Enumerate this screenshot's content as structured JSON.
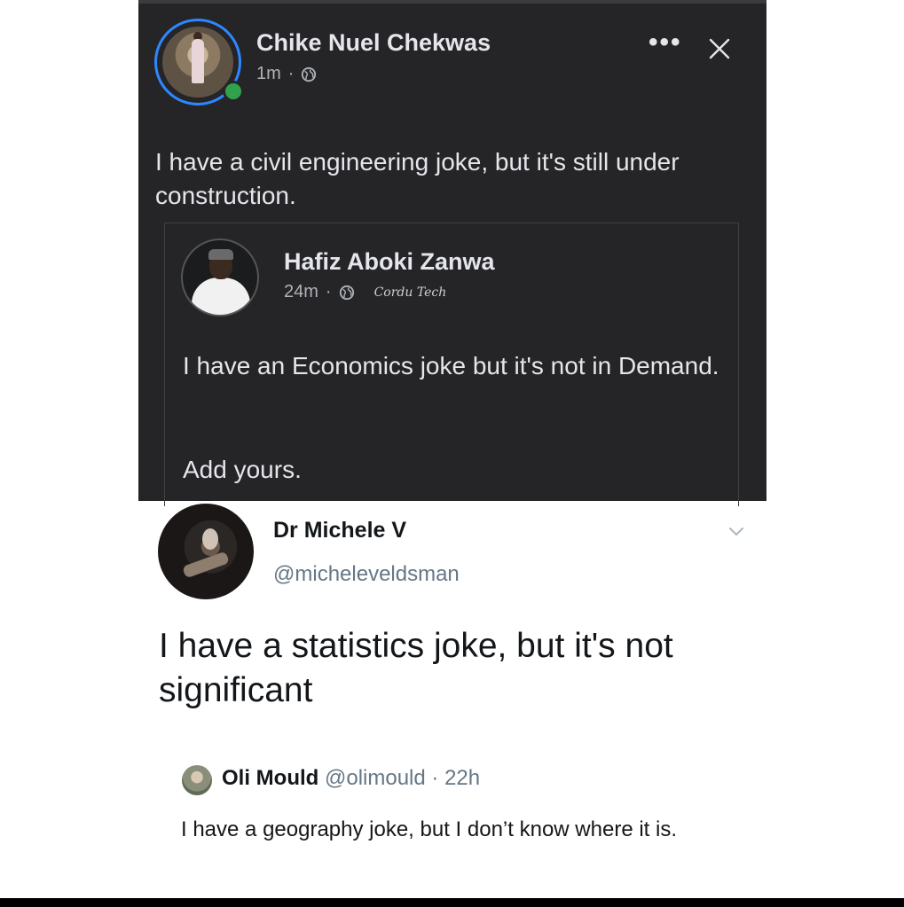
{
  "facebook_post": {
    "author": {
      "name": "Chike Nuel Chekwas",
      "time": "1m",
      "separator": "·"
    },
    "text": "I have a civil engineering joke, but it's still under construction.",
    "shared_post": {
      "author": {
        "name": "Hafiz Aboki Zanwa",
        "time": "24m",
        "separator": "·"
      },
      "signature": "Cordu Tech",
      "text": "I have an Economics joke but it's not in Demand.",
      "add_yours": "Add yours."
    },
    "icons": {
      "more": "more-options-icon",
      "close": "close-icon",
      "privacy": "globe-icon"
    },
    "colors": {
      "background": "#252527",
      "online": "#31a24c",
      "ring": "#2d88ff"
    }
  },
  "tweet": {
    "author": {
      "name": "Dr Michele V",
      "handle": "@micheleveldsman"
    },
    "text": "I have a statistics joke, but it's not significant",
    "reply": {
      "name": "Oli Mould",
      "handle": "@olimould",
      "separator": "·",
      "time": "22h",
      "text": "I have a geography joke, but I don’t know where it is."
    }
  }
}
